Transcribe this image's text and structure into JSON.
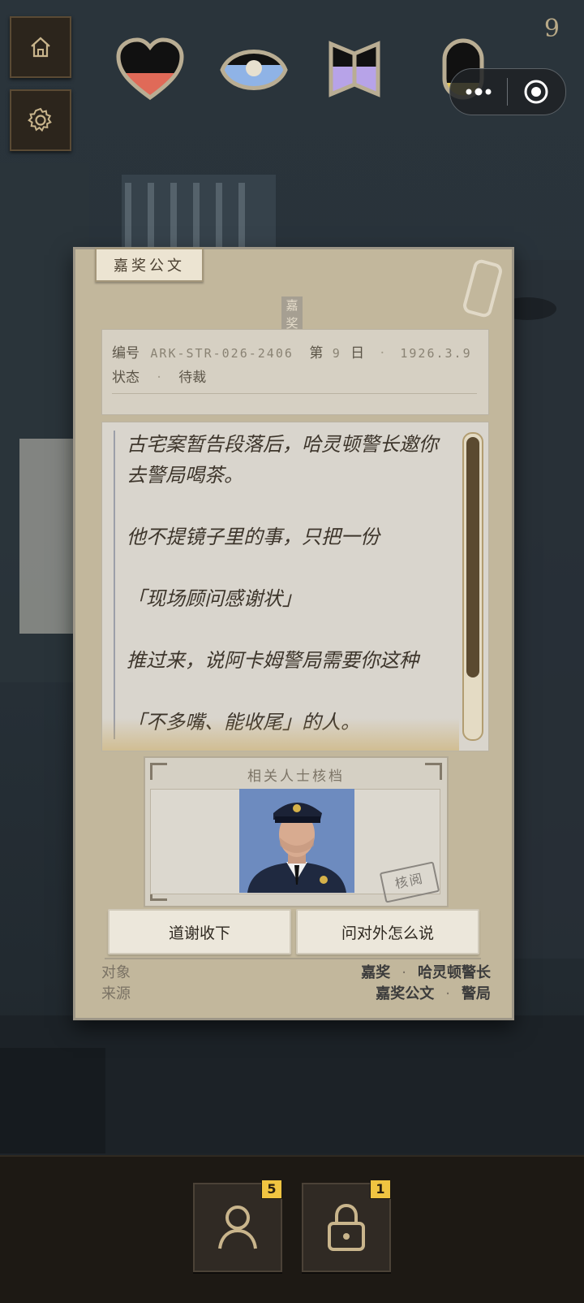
{
  "hud": {
    "corner_number": "9",
    "stats": [
      {
        "name": "heart",
        "fill_fraction": 0.45,
        "color": "#e06a58"
      },
      {
        "name": "eye",
        "fill_fraction": 0.6,
        "color": "#8fb3e6"
      },
      {
        "name": "book",
        "fill_fraction": 0.55,
        "color": "#b7a3e8"
      },
      {
        "name": "lock",
        "fill_fraction": 0.3,
        "color": "#e2c55b"
      }
    ]
  },
  "card": {
    "tab_label": "嘉奖公文",
    "ribbon_label": "嘉奖",
    "meta": {
      "id_label": "编号",
      "id_value": "ARK-STR-026-2406",
      "day_label": "第",
      "day_value": "9",
      "day_suffix": "日",
      "sep": "·",
      "date": "1926.3.9",
      "status_label": "状态",
      "status_value": "待裁"
    },
    "story": [
      "古宅案暂告段落后，哈灵顿警长邀你去警局喝茶。",
      "他不提镜子里的事，只把一份",
      "「现场顾问感谢状」",
      "推过来，说阿卡姆警局需要你这种",
      "「不多嘴、能收尾」的人。"
    ],
    "dossier": {
      "title": "相关人士核档",
      "stamp": "核阅"
    },
    "choices": [
      "道谢收下",
      "问对外怎么说"
    ],
    "footer": {
      "target_label": "对象",
      "target_values": [
        "嘉奖",
        "哈灵顿警长"
      ],
      "source_label": "来源",
      "source_values": [
        "嘉奖公文",
        "警局"
      ],
      "sep": "·"
    }
  },
  "bottom": {
    "slots": [
      {
        "name": "person",
        "badge": "5"
      },
      {
        "name": "lock",
        "badge": "1"
      }
    ]
  }
}
